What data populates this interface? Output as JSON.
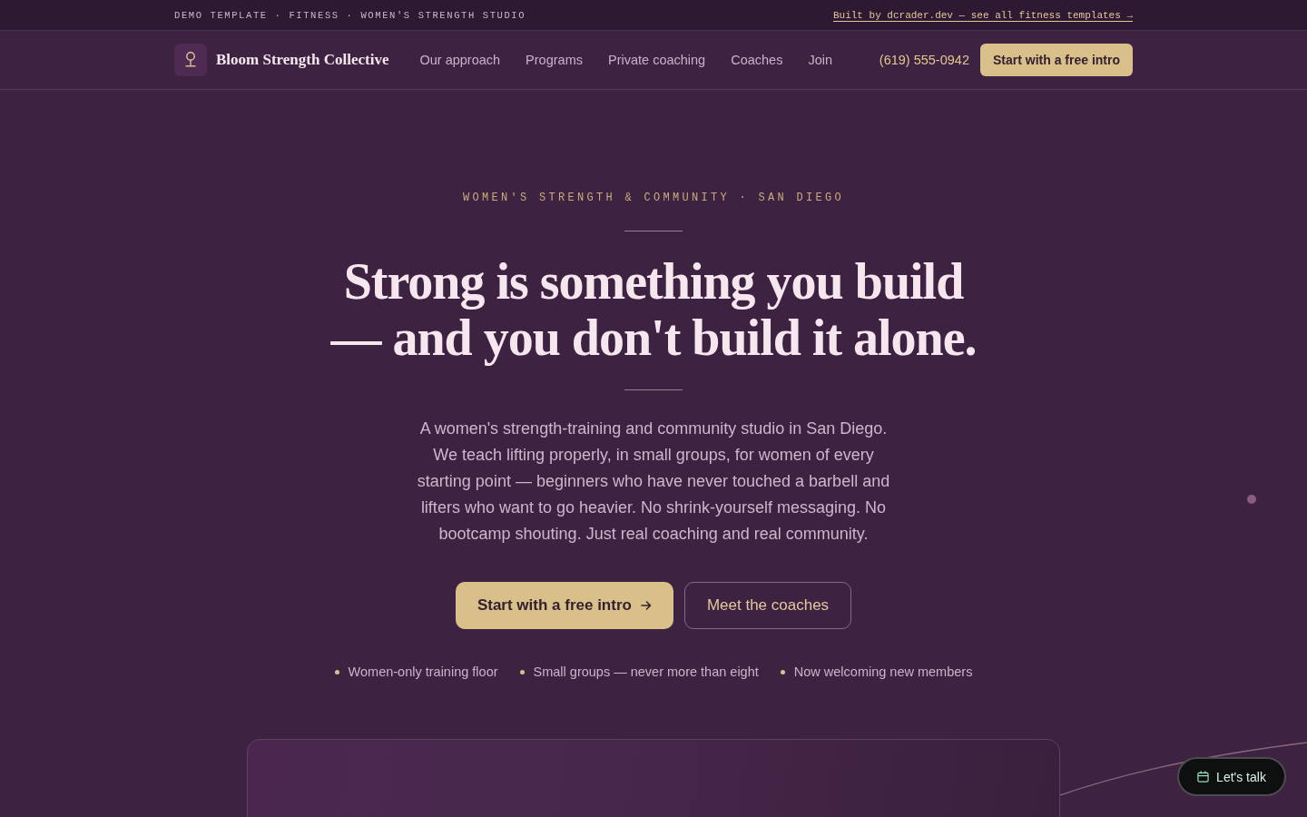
{
  "top_bar": {
    "tagline": "DEMO TEMPLATE · FITNESS · WOMEN'S STRENGTH STUDIO",
    "credit_link": "Built by dcrader.dev — see all fitness templates →"
  },
  "nav": {
    "brand": "Bloom Strength Collective",
    "links": [
      "Our approach",
      "Programs",
      "Private coaching",
      "Coaches",
      "Join"
    ],
    "phone": "(619) 555-0942",
    "cta": "Start with a free intro"
  },
  "hero": {
    "eyebrow": "WOMEN'S STRENGTH & COMMUNITY · SAN DIEGO",
    "headline": "Strong is something you build — and you don't build it alone.",
    "intro": "A women's strength-training and community studio in San Diego. We teach lifting properly, in small groups, for women of every starting point — beginners who have never touched a barbell and lifters who want to go heavier. No shrink-yourself messaging. No bootcamp shouting. Just real coaching and real community.",
    "buttons": [
      {
        "label": "Start with a free intro",
        "kind": "primary"
      },
      {
        "label": "Meet the coaches",
        "kind": "secondary"
      }
    ],
    "highlights": [
      "Women-only training floor",
      "Small groups — never more than eight",
      "Now welcoming new members"
    ]
  },
  "chat_button": {
    "label": "Let's talk"
  }
}
